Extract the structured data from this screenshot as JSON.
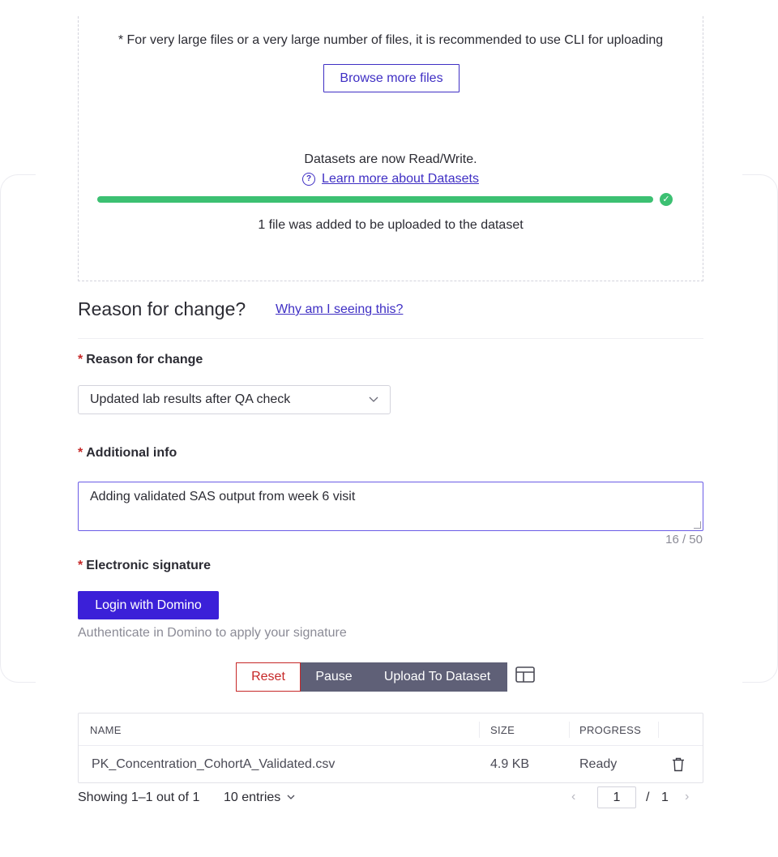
{
  "upload": {
    "cli_note": "* For very large files or a very large number of files, it is recommended to use CLI for uploading",
    "browse_label": "Browse more files",
    "readwrite_text": "Datasets are now Read/Write.",
    "learn_more_label": "Learn more about Datasets",
    "progress_percent": 100,
    "added_text": "1 file was added to be uploaded to the dataset"
  },
  "reason": {
    "section_title": "Reason for change?",
    "why_link": "Why am I seeing this?",
    "reason_label": "Reason for change",
    "reason_value": "Updated lab results after QA check",
    "info_label": "Additional info",
    "info_value": "Adding validated SAS output from week 6 visit",
    "char_count": "16 / 50",
    "signature_label": "Electronic signature",
    "login_label": "Login with Domino",
    "signature_helper": "Authenticate in Domino to apply your signature",
    "required_mark": "*"
  },
  "actions": {
    "reset_label": "Reset",
    "pause_label": "Pause",
    "upload_label": "Upload To Dataset"
  },
  "table": {
    "columns": [
      "NAME",
      "SIZE",
      "PROGRESS"
    ],
    "rows": [
      {
        "name": "PK_Concentration_CohortA_Validated.csv",
        "size": "4.9 KB",
        "progress": "Ready"
      }
    ]
  },
  "footer": {
    "showing_text": "Showing 1–1 out of 1",
    "entries_label": "10 entries",
    "current_page": "1",
    "page_separator": "/",
    "total_pages": "1"
  },
  "colors": {
    "accent": "#3b20d8",
    "link": "#3f2fc4",
    "success": "#3cc072",
    "danger": "#c62828",
    "secondary_button": "#5f6077"
  },
  "icons": [
    "help-icon",
    "check-circle-icon",
    "chevron-down-icon",
    "layout-icon",
    "trash-icon",
    "chevron-left-icon",
    "chevron-right-icon"
  ]
}
